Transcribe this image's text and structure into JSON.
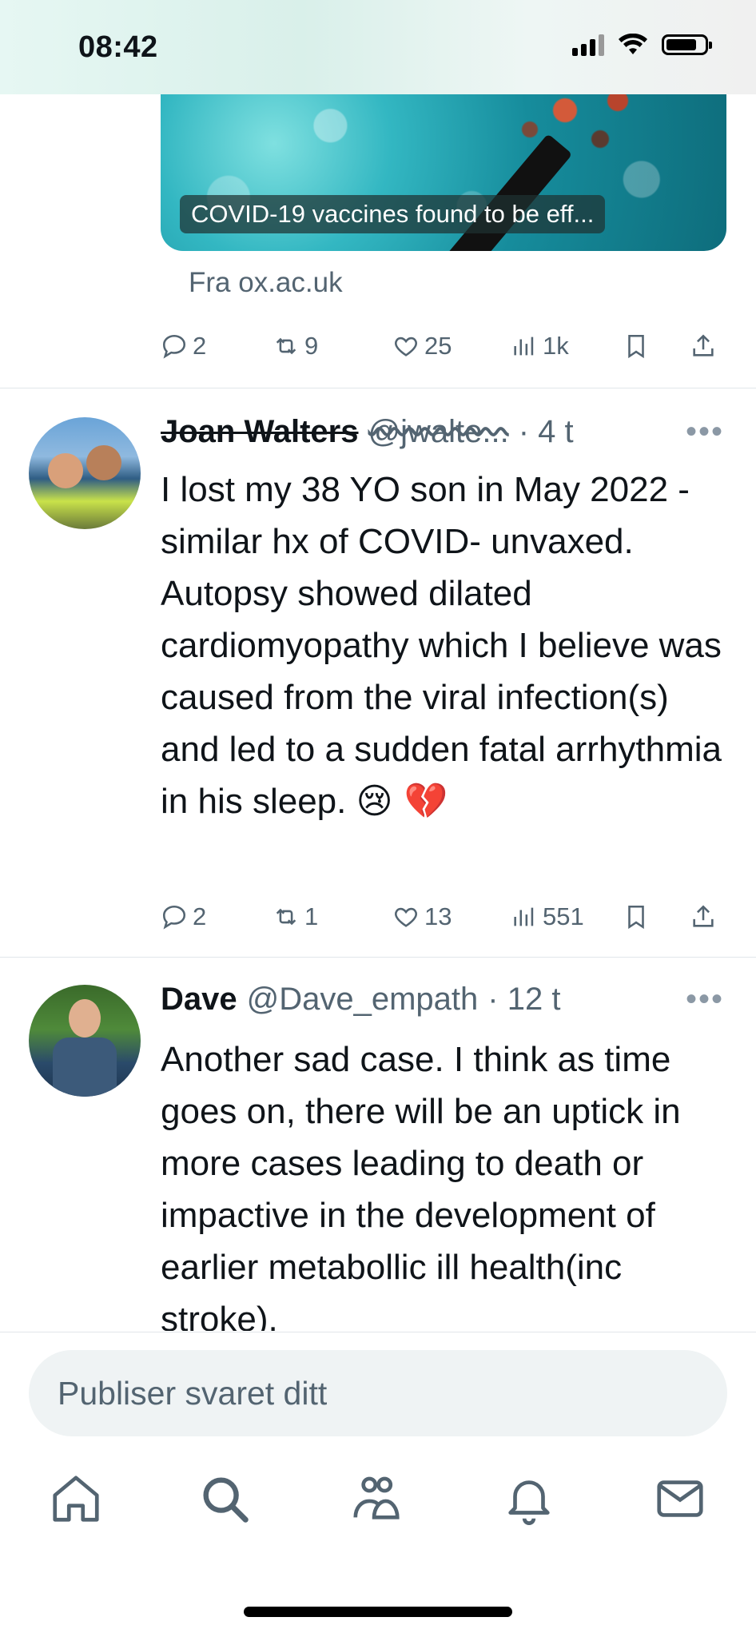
{
  "status_bar": {
    "time": "08:42"
  },
  "link_card": {
    "caption": "COVID-19 vaccines found to be eff...",
    "source": "Fra ox.ac.uk"
  },
  "tweet0_actions": {
    "replies": "2",
    "reposts": "9",
    "likes": "25",
    "views": "1k"
  },
  "tweets": [
    {
      "name": "Joan Walters",
      "handle": "@jwalte...",
      "time": "· 4 t",
      "text": "I lost my 38 YO son in May 2022 - similar hx of COVID- unvaxed. Autopsy showed dilated cardiomyopathy which I believe was caused from the viral infection(s) and led to a sudden fatal arrhythmia in his sleep.",
      "emoji": "😢 💔",
      "actions": {
        "replies": "2",
        "reposts": "1",
        "likes": "13",
        "views": "551"
      }
    },
    {
      "name": "Dave",
      "handle": "@Dave_empath",
      "time": "· 12 t",
      "text": "Another sad case. I think as time goes on, there will be an uptick in more cases leading to death or impactive in the development of earlier metabollic ill health(inc stroke)."
    }
  ],
  "more_label": "•••",
  "reply_placeholder": "Publiser svaret ditt",
  "nav": [
    "home-icon",
    "search-icon",
    "communities-icon",
    "notifications-icon",
    "messages-icon"
  ]
}
